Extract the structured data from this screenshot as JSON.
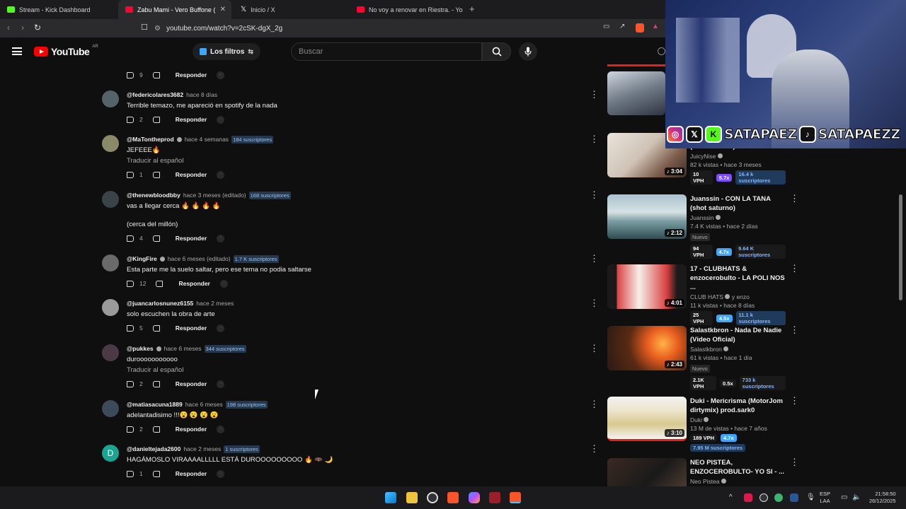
{
  "browser": {
    "tabs": [
      {
        "label": "Stream - Kick Dashboard",
        "color": "#53fc18"
      },
      {
        "label": "Zabu Mami - Vero Buffone (VIDE",
        "color": "#ff0033"
      },
      {
        "label": "Inicio / X",
        "color": "#ffffff"
      },
      {
        "label": "No voy a renovar en Riestra. - YouTu",
        "color": "#ff0033"
      }
    ],
    "url": "youtube.com/watch?v=2cSK-dgX_2g"
  },
  "header": {
    "logo_text": "YouTube",
    "region": "AR",
    "filters_label": "Los filtros",
    "search_placeholder": "Buscar"
  },
  "comments": [
    {
      "handle": "",
      "time": "",
      "badge": "",
      "text": "",
      "likes": "9",
      "reply": "Responder"
    },
    {
      "handle": "@federicolares3682",
      "time": "hace 8 días",
      "badge": "",
      "text": "Terrible temazo,  me apareció en spotify de la nada",
      "likes": "2",
      "reply": "Responder"
    },
    {
      "handle": "@MaTontheprod",
      "time": "hace 4 semanas",
      "badge": "184 suscriptores",
      "text": "JEFEEE🔥",
      "translate": "Traducir al español",
      "likes": "1",
      "reply": "Responder"
    },
    {
      "handle": "@thenewbloodbby",
      "time": "hace 3 meses (editado)",
      "badge": "168 suscriptores",
      "text": "vas a llegar cerca 🔥 🔥 🔥 🔥",
      "text2": "(cerca del millón)",
      "likes": "4",
      "reply": "Responder"
    },
    {
      "handle": "@KingFire",
      "time": "hace 6 meses (editado)",
      "badge": "1.7 K suscriptores",
      "text": "Esta parte me la suelo saltar, pero ese tema no podia saltarse",
      "likes": "12",
      "reply": "Responder"
    },
    {
      "handle": "@juancarlosnunez6155",
      "time": "hace 2 meses",
      "badge": "",
      "text": "solo escuchen la obra de arte",
      "likes": "5",
      "reply": "Responder"
    },
    {
      "handle": "@pukkes",
      "time": "hace 6 meses",
      "badge": "344 suscriptores",
      "text": "durooooooooooo",
      "translate": "Traducir al español",
      "likes": "2",
      "reply": "Responder"
    },
    {
      "handle": "@matiasacuna1889",
      "time": "hace 6 meses",
      "badge": "198 suscriptores",
      "text": "adelantadisimo !!!😮 😮 😮 😮",
      "likes": "2",
      "reply": "Responder"
    },
    {
      "handle": "@danieltejada2600",
      "time": "hace 2 meses",
      "badge": "1 suscriptores",
      "text": "HAGÁMOSLO VIRAAAALLLLL ESTÁ DUROOOOOOOOO 🔥 🦇 🌙",
      "likes": "1",
      "reply": "Responder",
      "avatar_letter": "D"
    }
  ],
  "sidebar": [
    {
      "title": "(Video Oficial)",
      "channel": "JuicyNise",
      "stats": "82 k vistas • hace 3 meses",
      "duration": "3:04",
      "vph": "10 VPH",
      "mult": "5.7x",
      "mult_color": "#7c4dff",
      "subs": "16.4 k suscriptores",
      "new": ""
    },
    {
      "title": "Juanssin - CON LA TANA (shot saturno)",
      "channel": "Juanssin",
      "stats": "7.4 K vistas • hace 2 días",
      "duration": "2:12",
      "vph": "94 VPH",
      "mult": "4.7x",
      "mult_color": "#3ea6ff",
      "subs": "9.64 K suscriptores",
      "new": "Nuevo"
    },
    {
      "title": "17 - CLUBHATS & enzocerobulto - LA POLI NOS ...",
      "channel": "CLUB HATS",
      "channel_extra": "y enzo",
      "stats": "11 k vistas • hace 8 días",
      "duration": "4:01",
      "vph": "25 VPH",
      "mult": "4.5x",
      "mult_color": "#3ea6ff",
      "subs": "11.1 k suscriptores",
      "new": ""
    },
    {
      "title": "Salastkbron - Nada De Nadie (Video Oficial)",
      "channel": "Salastkbron",
      "stats": "61 k vistas • hace 1 día",
      "duration": "2:43",
      "vph": "2.1K VPH",
      "mult": "0.5x",
      "mult_color": "#2a2a2a",
      "subs": "733 k suscriptores",
      "new": "Nuevo"
    },
    {
      "title": "Duki -  Mericrisma (MotorJom dirtymix) prod.sark0",
      "channel": "Duki",
      "stats": "13 M de vistas • hace 7 años",
      "duration": "3:10",
      "vph": "189 VPH",
      "mult": "4.7x",
      "mult_color": "#3ea6ff",
      "subs": "7.95 M suscriptores",
      "new": ""
    },
    {
      "title": "NEO PISTEA, ENZOCEROBULTO- YO SI - ...",
      "channel": "Neo Pistea",
      "stats": "",
      "duration": "",
      "vph": "",
      "mult": "",
      "mult_color": "",
      "subs": "",
      "new": ""
    }
  ],
  "overlay": {
    "handle1": "SATAPAEZ",
    "handle2": "SATAPAEZZ"
  },
  "taskbar": {
    "lang1": "ESP",
    "lang2": "LAA",
    "time": "21:58:50",
    "date": "26/12/2025"
  }
}
